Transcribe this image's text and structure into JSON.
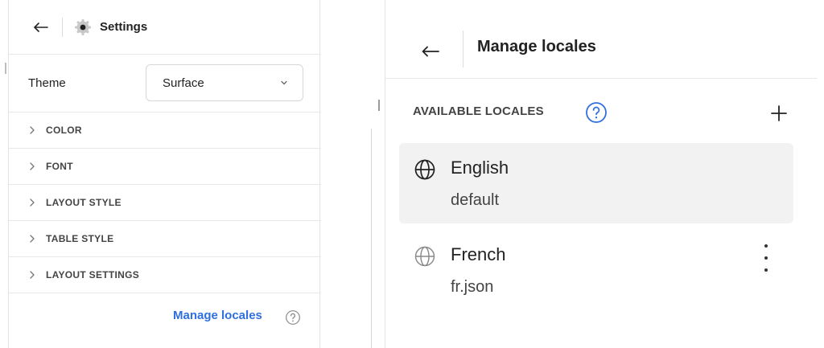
{
  "left_panel": {
    "header": {
      "title": "Settings"
    },
    "theme": {
      "label": "Theme",
      "selected_value": "Surface"
    },
    "sections": [
      {
        "label": "COLOR"
      },
      {
        "label": "FONT"
      },
      {
        "label": "LAYOUT STYLE"
      },
      {
        "label": "TABLE STYLE"
      },
      {
        "label": "LAYOUT SETTINGS"
      }
    ],
    "footer": {
      "manage_link": "Manage locales"
    }
  },
  "right_panel": {
    "header": {
      "title": "Manage locales"
    },
    "available_label": "AVAILABLE LOCALES",
    "locales": [
      {
        "name": "English",
        "subtitle": "default",
        "selected": true
      },
      {
        "name": "French",
        "subtitle": "fr.json",
        "selected": false
      }
    ]
  },
  "colors": {
    "link": "#2f6fdf",
    "help_icon": "#2f6fdf",
    "selected_row": "#f2f2f2"
  },
  "icons": {
    "back": "arrow-left-icon",
    "settings": "gear-icon",
    "dropdown": "chevron-down-icon",
    "section": "chevron-right-icon",
    "help": "question-circle-icon",
    "add": "plus-icon",
    "locale": "globe-icon",
    "more": "kebab-menu-icon"
  }
}
